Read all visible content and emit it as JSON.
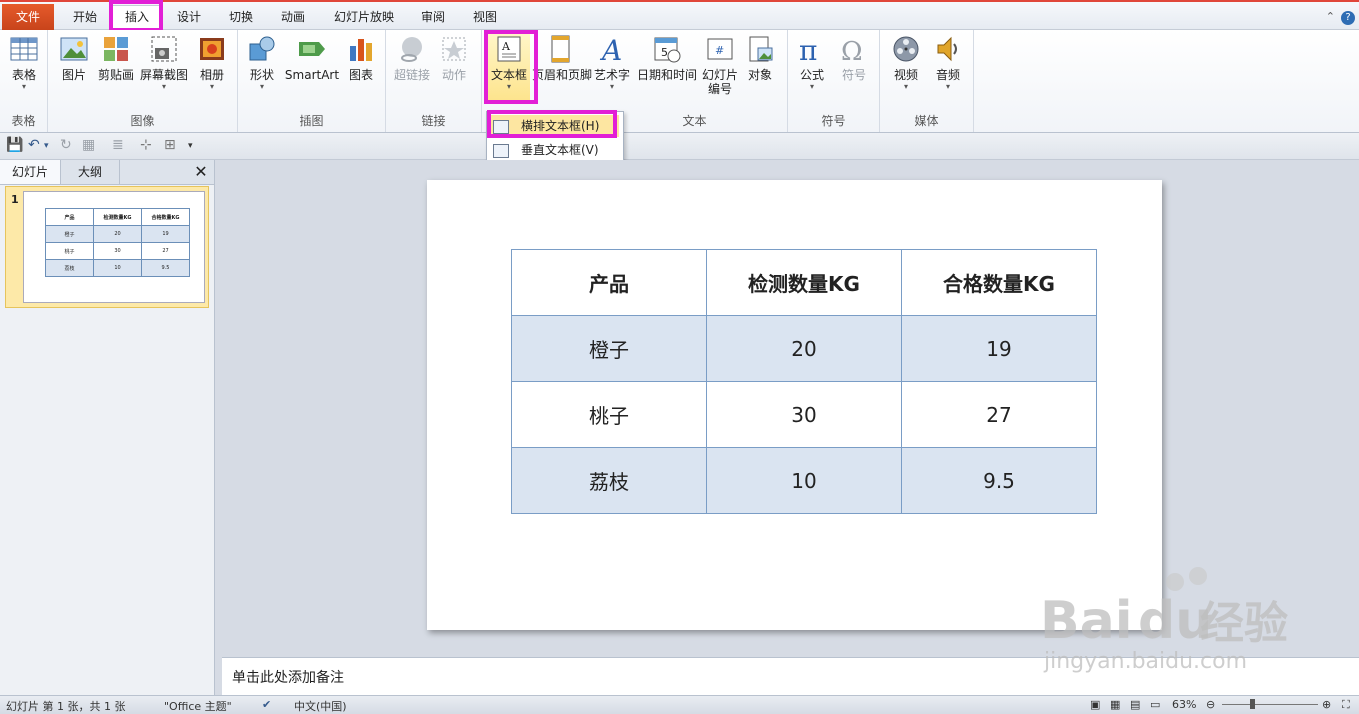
{
  "tabs": {
    "file": "文件",
    "home": "开始",
    "insert": "插入",
    "design": "设计",
    "transitions": "切换",
    "animations": "动画",
    "slideshow": "幻灯片放映",
    "review": "审阅",
    "view": "视图"
  },
  "ribbon": {
    "groups": {
      "table": "表格",
      "images": "图像",
      "illustrations": "插图",
      "links": "链接",
      "text": "文本",
      "symbols": "符号",
      "media": "媒体"
    },
    "buttons": {
      "table": "表格",
      "picture": "图片",
      "clipart": "剪贴画",
      "screenshot": "屏幕截图",
      "album": "相册",
      "shapes": "形状",
      "smartart": "SmartArt",
      "chart": "图表",
      "hyperlink": "超链接",
      "action": "动作",
      "textbox": "文本框",
      "header_footer": "页眉和页脚",
      "wordart": "艺术字",
      "datetime": "日期和时间",
      "slide_number_1": "幻灯片",
      "slide_number_2": "编号",
      "object": "对象",
      "equation": "公式",
      "symbol": "符号",
      "video": "视频",
      "audio": "音频"
    }
  },
  "dropdown": {
    "horizontal": "横排文本框(H)",
    "vertical": "垂直文本框(V)"
  },
  "panel": {
    "tab_slides": "幻灯片",
    "tab_outline": "大纲",
    "slide_index": "1"
  },
  "table": {
    "headers": [
      "产品",
      "检测数量KG",
      "合格数量KG"
    ],
    "rows": [
      [
        "橙子",
        "20",
        "19"
      ],
      [
        "桃子",
        "30",
        "27"
      ],
      [
        "荔枝",
        "10",
        "9.5"
      ]
    ]
  },
  "notes": {
    "placeholder": "单击此处添加备注"
  },
  "status": {
    "slide_info": "幻灯片 第 1 张，共 1 张",
    "theme": "\"Office 主题\"",
    "language": "中文(中国)",
    "zoom": "63%"
  },
  "watermark": {
    "brand": "Bai",
    "brand2": "du",
    "brand_cn": "经验",
    "url": "jingyan.baidu.com"
  },
  "colors": {
    "highlight": "#e21fd6",
    "table_border": "#7a9dc6",
    "table_shade": "#dae4f1",
    "file_tab": "#d44d1f"
  }
}
